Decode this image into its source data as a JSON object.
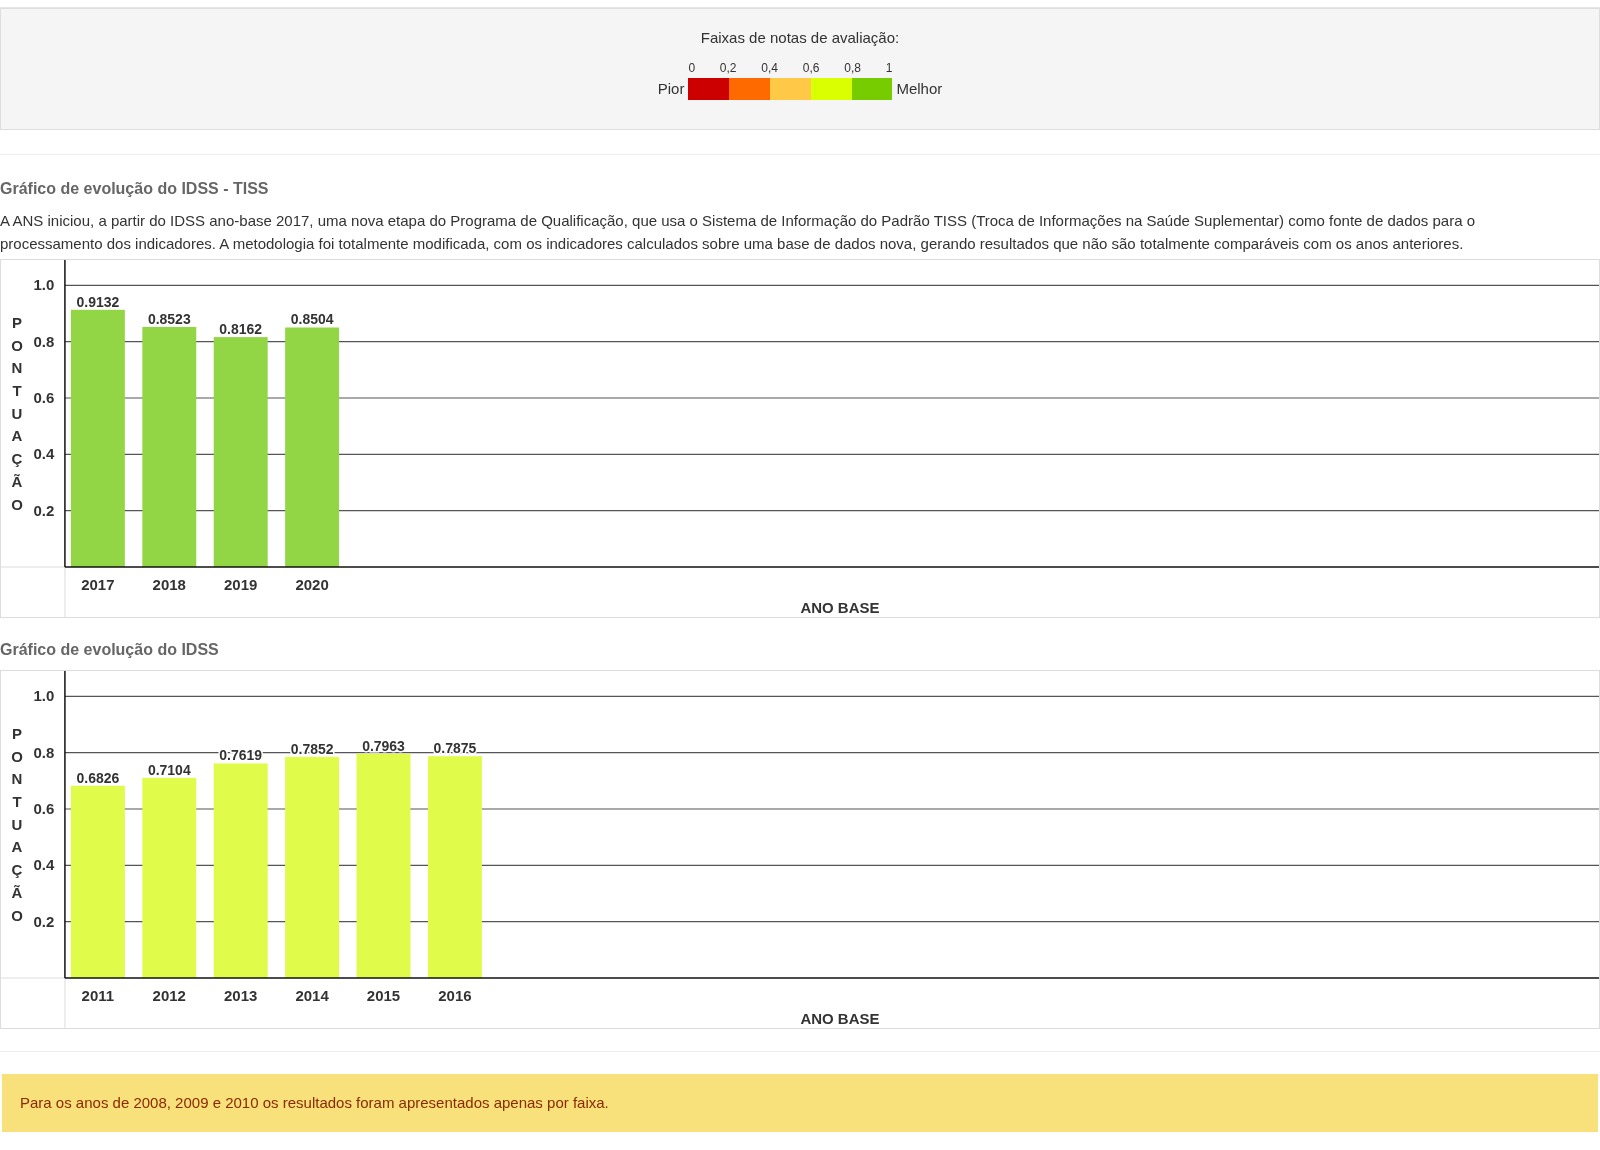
{
  "legend": {
    "title": "Faixas de notas de avaliação:",
    "worst": "Pior",
    "best": "Melhor",
    "ticks": [
      "0",
      "0,2",
      "0,4",
      "0,6",
      "0,8",
      "1"
    ],
    "bands": [
      {
        "color": "#cc0000"
      },
      {
        "color": "#ff6a00"
      },
      {
        "color": "#ffc846"
      },
      {
        "color": "#d9ff00"
      },
      {
        "color": "#77cc00"
      }
    ]
  },
  "sections": [
    {
      "title": "Gráfico de evolução do IDSS - TISS",
      "text": "A ANS iniciou, a partir do IDSS ano-base 2017, uma nova etapa do Programa de Qualificação, que usa o Sistema de Informação do Padrão TISS (Troca de Informações na Saúde Suplementar) como fonte de dados para o processamento dos indicadores. A metodologia foi totalmente modificada, com os indicadores calculados sobre uma base de dados nova, gerando resultados que não são totalmente comparáveis com os anos anteriores.",
      "x_title": "ANO BASE",
      "chart_data": {
        "type": "bar",
        "ylabel": "PONTUAÇÃO",
        "grid": true,
        "categories": [
          "2017",
          "2018",
          "2019",
          "2020"
        ],
        "series": [
          {
            "color": "#92d645",
            "values": [
              0.9132,
              0.8523,
              0.8162,
              0.8504
            ]
          }
        ],
        "value_labels": [
          "0.9132",
          "0.8523",
          "0.8162",
          "0.8504"
        ],
        "ylim": [
          0,
          1.09
        ],
        "yticks": [
          {
            "value": 0.2,
            "label": "0.2"
          },
          {
            "value": 0.4,
            "label": "0.4"
          },
          {
            "value": 0.6,
            "label": "0.6"
          },
          {
            "value": 0.8,
            "label": "0.8"
          },
          {
            "value": 1,
            "label": "1.0"
          }
        ]
      }
    },
    {
      "title": "Gráfico de evolução do IDSS",
      "x_title": "ANO BASE",
      "chart_data": {
        "type": "bar",
        "ylabel": "PONTUAÇÃO",
        "grid": true,
        "categories": [
          "2011",
          "2012",
          "2013",
          "2014",
          "2015",
          "2016"
        ],
        "series": [
          {
            "color": "#e0fb4a",
            "values": [
              0.6826,
              0.7104,
              0.7619,
              0.7852,
              0.7963,
              0.7875
            ]
          }
        ],
        "value_labels": [
          "0.6826",
          "0.7104",
          "0.7619",
          "0.7852",
          "0.7963",
          "0.7875"
        ],
        "ylim": [
          0,
          1.09
        ],
        "yticks": [
          {
            "value": 0.2,
            "label": "0.2"
          },
          {
            "value": 0.4,
            "label": "0.4"
          },
          {
            "value": 0.6,
            "label": "0.6"
          },
          {
            "value": 0.8,
            "label": "0.8"
          },
          {
            "value": 1,
            "label": "1.0"
          }
        ]
      }
    }
  ],
  "notice": "Para os anos de 2008, 2009 e 2010 os resultados foram apresentados apenas por faixa."
}
